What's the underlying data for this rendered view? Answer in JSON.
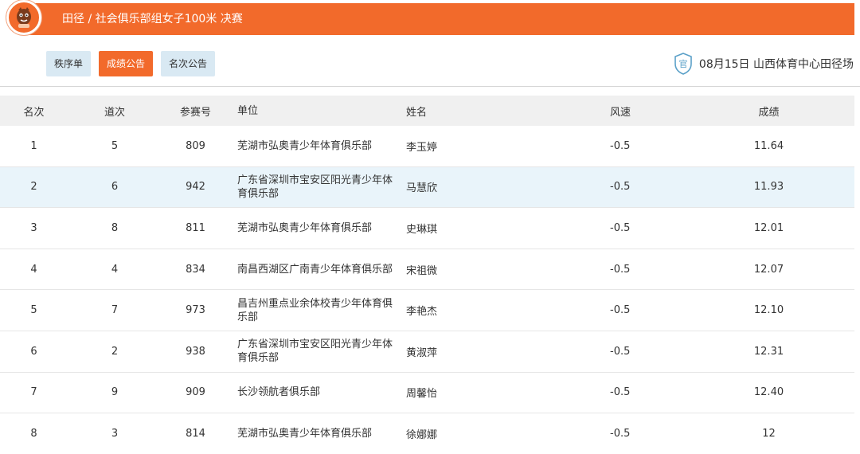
{
  "header": {
    "title": "田径 / 社会俱乐部组女子100米  决赛"
  },
  "tabs": [
    {
      "label": "秩序单",
      "active": false
    },
    {
      "label": "成绩公告",
      "active": true
    },
    {
      "label": "名次公告",
      "active": false
    }
  ],
  "venue": {
    "icon_label": "官",
    "text": "08月15日  山西体育中心田径场"
  },
  "table": {
    "headers": {
      "rank": "名次",
      "lane": "道次",
      "bib": "参赛号",
      "unit": "单位",
      "name": "姓名",
      "wind": "风速",
      "result": "成绩"
    },
    "rows": [
      {
        "rank": "1",
        "lane": "5",
        "bib": "809",
        "unit": "芜湖市弘奥青少年体育俱乐部",
        "name": "李玉婷",
        "wind": "-0.5",
        "result": "11.64"
      },
      {
        "rank": "2",
        "lane": "6",
        "bib": "942",
        "unit": "广东省深圳市宝安区阳光青少年体育俱乐部",
        "name": "马慧欣",
        "wind": "-0.5",
        "result": "11.93"
      },
      {
        "rank": "3",
        "lane": "8",
        "bib": "811",
        "unit": "芜湖市弘奥青少年体育俱乐部",
        "name": "史琳琪",
        "wind": "-0.5",
        "result": "12.01"
      },
      {
        "rank": "4",
        "lane": "4",
        "bib": "834",
        "unit": "南昌西湖区广南青少年体育俱乐部",
        "name": "宋祖微",
        "wind": "-0.5",
        "result": "12.07"
      },
      {
        "rank": "5",
        "lane": "7",
        "bib": "973",
        "unit": "昌吉州重点业余体校青少年体育俱乐部",
        "name": "李艳杰",
        "wind": "-0.5",
        "result": "12.10"
      },
      {
        "rank": "6",
        "lane": "2",
        "bib": "938",
        "unit": "广东省深圳市宝安区阳光青少年体育俱乐部",
        "name": "黄淑萍",
        "wind": "-0.5",
        "result": "12.31"
      },
      {
        "rank": "7",
        "lane": "9",
        "bib": "909",
        "unit": "长沙领航者俱乐部",
        "name": "周馨怡",
        "wind": "-0.5",
        "result": "12.40"
      },
      {
        "rank": "8",
        "lane": "3",
        "bib": "814",
        "unit": "芜湖市弘奥青少年体育俱乐部",
        "name": "徐娜娜",
        "wind": "-0.5",
        "result": "12"
      }
    ]
  },
  "colors": {
    "brand": "#f26a2b",
    "tab_inactive": "#d9e9f3",
    "row_highlight": "#e9f4fa",
    "header_row": "#f0f0f0"
  },
  "icons": {
    "logo": "mascot-logo-icon",
    "venue": "official-badge-icon"
  }
}
